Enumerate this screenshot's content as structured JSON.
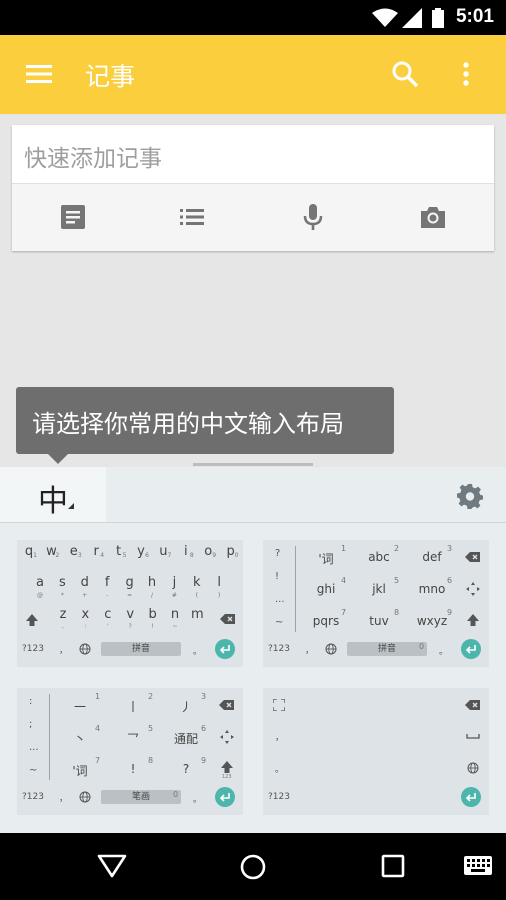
{
  "status_bar": {
    "time": "5:01"
  },
  "app_bar": {
    "title": "记事"
  },
  "note_card": {
    "placeholder": "快速添加记事"
  },
  "tooltip": {
    "text": "请选择你常用的中文输入布局"
  },
  "keyboard_panel": {
    "selected_tab": "中",
    "layouts": {
      "pinyin_qwerty": {
        "row1": [
          "q",
          "w",
          "e",
          "r",
          "t",
          "y",
          "u",
          "i",
          "o",
          "p"
        ],
        "row1_sub": [
          "1",
          "2",
          "3",
          "4",
          "5",
          "6",
          "7",
          "8",
          "9",
          "0"
        ],
        "row2": [
          "a",
          "s",
          "d",
          "f",
          "g",
          "h",
          "j",
          "k",
          "l"
        ],
        "row2_sub": [
          "@",
          "*",
          "+",
          "-",
          "=",
          "/",
          "#",
          "(",
          ")"
        ],
        "row3": [
          "z",
          "x",
          "c",
          "v",
          "b",
          "n",
          "m"
        ],
        "row3_sub": [
          ",",
          ":",
          "'",
          "?",
          "!",
          "~",
          ""
        ],
        "sym_key": "?123",
        "comma": "，",
        "space_label": "拼音",
        "period": "。"
      },
      "pinyin_t9": {
        "left_col": [
          "?",
          "!",
          "...",
          "~"
        ],
        "keys": [
          "'词",
          "abc",
          "def",
          "ghi",
          "jkl",
          "mno",
          "pqrs",
          "tuv",
          "wxyz"
        ],
        "key_nums": [
          "1",
          "2",
          "3",
          "4",
          "5",
          "6",
          "7",
          "8",
          "9"
        ],
        "sym_key": "?123",
        "comma": "，",
        "space_label": "拼音",
        "space_num": "0",
        "period": "。"
      },
      "stroke": {
        "left_col": [
          ":",
          ";",
          "...",
          "~"
        ],
        "keys": [
          "一",
          "丨",
          "丿",
          "丶",
          "乛",
          "通配",
          "'词",
          "!",
          "?"
        ],
        "key_nums": [
          "1",
          "2",
          "3",
          "4",
          "5",
          "6",
          "7",
          "8",
          "9"
        ],
        "side_label": "123",
        "sym_key": "?123",
        "comma": "，",
        "space_label": "笔画",
        "space_num": "0",
        "period": "。"
      },
      "handwriting": {
        "comma": "，",
        "period": "。",
        "sym_key": "?123"
      }
    }
  }
}
